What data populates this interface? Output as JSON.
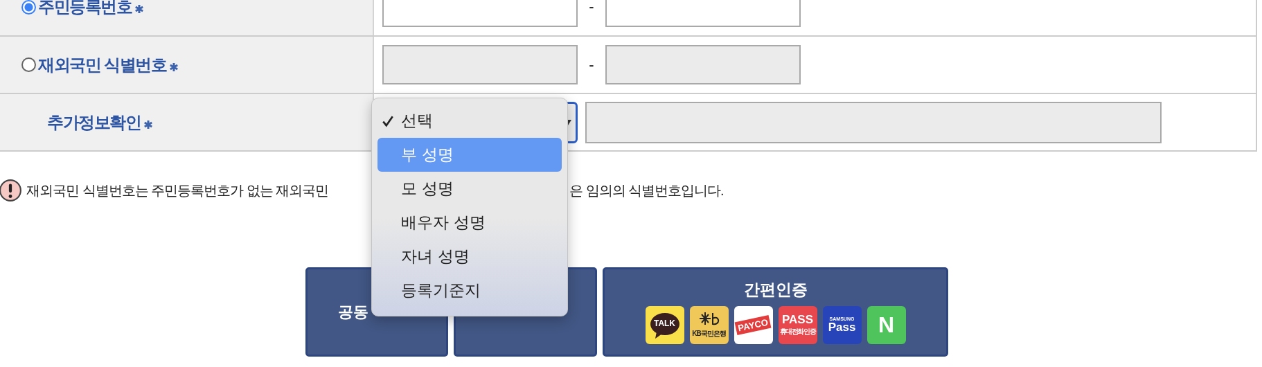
{
  "form": {
    "rows": [
      {
        "kind": "radio",
        "label": "주민등록번호",
        "selected": true,
        "required": true,
        "separator": "-",
        "inputs": [
          {
            "disabled": false
          },
          {
            "disabled": false
          }
        ]
      },
      {
        "kind": "radio",
        "label": "재외국민 식별번호",
        "selected": false,
        "required": true,
        "separator": "-",
        "inputs": [
          {
            "disabled": true
          },
          {
            "disabled": true
          }
        ]
      },
      {
        "kind": "select",
        "label": "추가정보확인",
        "required": true,
        "input": {
          "disabled": true
        }
      }
    ]
  },
  "dropdown": {
    "options": [
      {
        "label": "선택",
        "checked": true,
        "highlighted": false
      },
      {
        "label": "부 성명",
        "checked": false,
        "highlighted": true
      },
      {
        "label": "모 성명",
        "checked": false,
        "highlighted": false
      },
      {
        "label": "배우자 성명",
        "checked": false,
        "highlighted": false
      },
      {
        "label": "자녀 성명",
        "checked": false,
        "highlighted": false
      },
      {
        "label": "등록기준지",
        "checked": false,
        "highlighted": false
      }
    ]
  },
  "notice": {
    "parts": [
      "재외국민 식별번호는 주민등록번호가 없는 재외국민",
      "은 임의의 식별번호입니다."
    ]
  },
  "buttons": [
    {
      "kind": "plain",
      "label": "공동"
    },
    {
      "kind": "plain"
    },
    {
      "kind": "providers",
      "label": "간편인증",
      "providers": [
        {
          "kind": "kakao",
          "texts": [
            "TALK"
          ]
        },
        {
          "kind": "kb",
          "texts": [
            "KB국민은행"
          ]
        },
        {
          "kind": "payco",
          "texts": [
            "PAYCO"
          ]
        },
        {
          "kind": "pass",
          "texts": [
            "PASS",
            "휴대전화 인증"
          ]
        },
        {
          "kind": "samsung",
          "texts": [
            "SAMSUNG",
            "Pass"
          ]
        },
        {
          "kind": "naver",
          "texts": [
            "N"
          ]
        }
      ]
    }
  ]
}
